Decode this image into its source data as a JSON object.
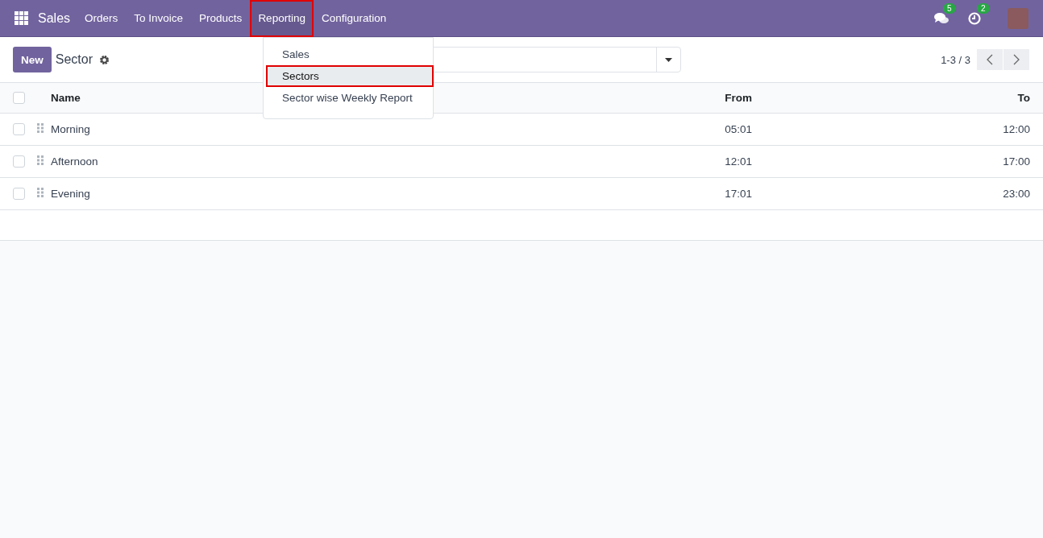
{
  "navbar": {
    "app_name": "Sales",
    "menu": [
      {
        "label": "Orders",
        "selected": false,
        "highlighted": false
      },
      {
        "label": "To Invoice",
        "selected": false,
        "highlighted": false
      },
      {
        "label": "Products",
        "selected": false,
        "highlighted": false
      },
      {
        "label": "Reporting",
        "selected": true,
        "highlighted": true
      },
      {
        "label": "Configuration",
        "selected": false,
        "highlighted": false
      }
    ],
    "messages_badge": "5",
    "activities_badge": "2"
  },
  "dropdown": {
    "items": [
      {
        "label": "Sales",
        "selected": false,
        "highlighted": false
      },
      {
        "label": "Sectors",
        "selected": true,
        "highlighted": true
      },
      {
        "label": "Sector wise Weekly Report",
        "selected": false,
        "highlighted": false
      }
    ]
  },
  "control_panel": {
    "new_button": "New",
    "title": "Sector",
    "pager": "1-3 / 3"
  },
  "table": {
    "select_all_checked": false,
    "columns": [
      "Name",
      "From",
      "To"
    ],
    "rows": [
      {
        "name": "Morning",
        "from": "05:01",
        "to": "12:00",
        "checked": false
      },
      {
        "name": "Afternoon",
        "from": "12:01",
        "to": "17:00",
        "checked": false
      },
      {
        "name": "Evening",
        "from": "17:01",
        "to": "23:00",
        "checked": false
      }
    ]
  }
}
